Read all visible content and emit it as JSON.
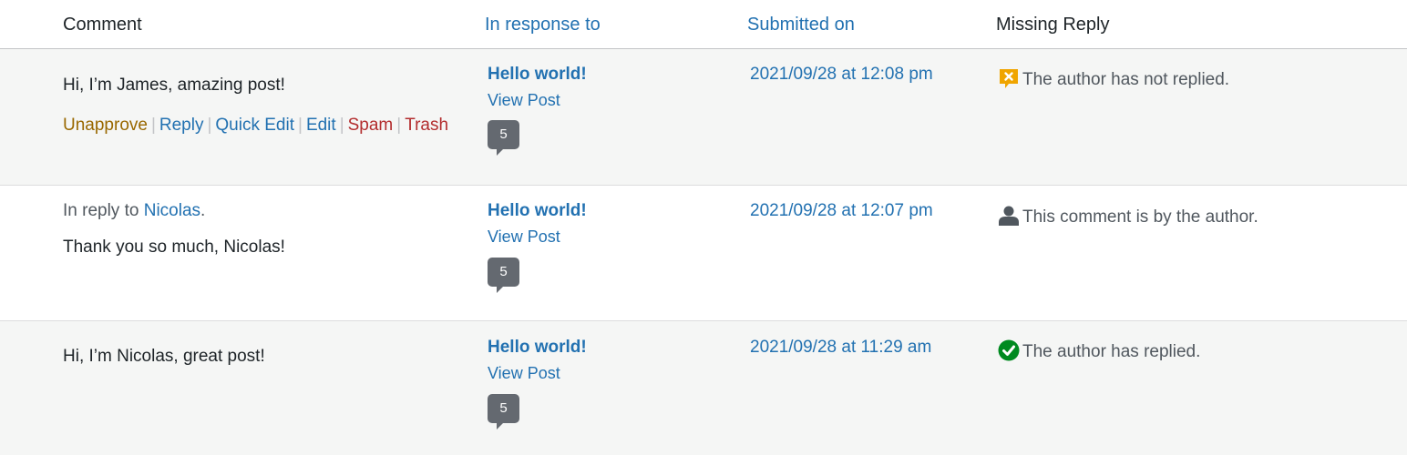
{
  "columns": {
    "comment": "Comment",
    "in_response_to": "In response to",
    "submitted_on": "Submitted on",
    "missing_reply": "Missing Reply"
  },
  "rows": [
    {
      "comment": "Hi, I’m James, amazing post!",
      "actions": {
        "unapprove": "Unapprove",
        "reply": "Reply",
        "quick_edit": "Quick Edit",
        "edit": "Edit",
        "spam": "Spam",
        "trash": "Trash"
      },
      "post_title": "Hello world!",
      "view_post": "View Post",
      "comment_count": "5",
      "submitted": "2021/09/28 at 12:08 pm",
      "status_icon": "not-replied-icon",
      "status_color": "#f0a500",
      "status_text": "The author has not replied."
    },
    {
      "reply_prefix": "In reply to",
      "reply_author": "Nicolas",
      "reply_suffix": ".",
      "comment": "Thank you so much, Nicolas!",
      "post_title": "Hello world!",
      "view_post": "View Post",
      "comment_count": "5",
      "submitted": "2021/09/28 at 12:07 pm",
      "status_icon": "author-icon",
      "status_color": "#50575e",
      "status_text": "This comment is by the author."
    },
    {
      "comment": "Hi, I’m Nicolas, great post!",
      "post_title": "Hello world!",
      "view_post": "View Post",
      "comment_count": "5",
      "submitted": "2021/09/28 at 11:29 am",
      "status_icon": "replied-check-icon",
      "status_color": "#008a20",
      "status_text": "The author has replied."
    }
  ]
}
